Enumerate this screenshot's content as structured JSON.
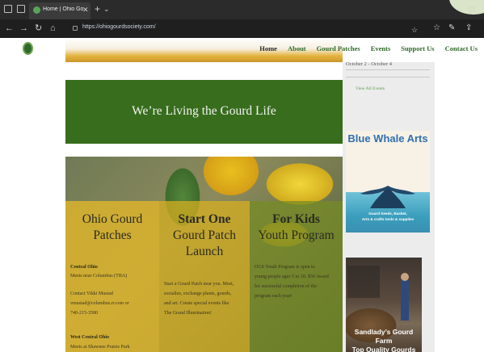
{
  "browser": {
    "tab_title": "Home | Ohio Gourd Soc",
    "tab_close": "✕",
    "new_tab": "+",
    "tab_menu": "⌄",
    "url": "https://ohiogourdsociety.com/",
    "window": {
      "minimize": "–",
      "restore": "◻"
    },
    "nav": {
      "back": "←",
      "forward": "→",
      "refresh": "↻",
      "home": "⌂"
    },
    "toolbar_icons": {
      "favorite_star": "☆",
      "collections": "☆",
      "profile": "✎",
      "share": "⇪"
    }
  },
  "site": {
    "nav": [
      "Home",
      "About",
      "Gourd Patches",
      "Events",
      "Support Us",
      "Contact Us"
    ],
    "banner": "We’re Living the Gourd Life",
    "columns": [
      {
        "title_line1": "Ohio Gourd",
        "title_line2": "Patches",
        "lines": [
          {
            "text": "Central Ohio",
            "bold": true
          },
          {
            "text": "Meets near Columbus (TBA)",
            "bold": false
          },
          {
            "text": "",
            "bold": false
          },
          {
            "text": "Contact Vikki Mustad",
            "bold": false
          },
          {
            "text": "vmustad@columbus.rr.com or",
            "bold": false
          },
          {
            "text": "740-215-3580",
            "bold": false
          },
          {
            "text": "",
            "bold": false
          },
          {
            "text": "West Central Ohio",
            "bold": true
          },
          {
            "text": "Meets at Shawnee Prairie Park",
            "bold": false
          }
        ]
      },
      {
        "title_line1": "Start One",
        "title_line2": "Gourd Patch",
        "title_line3": "Launch",
        "lines": [
          "Start a Gourd Patch near you. Meet,",
          "socialize, exchange plants, gourds,",
          "and art. Create special events like",
          "The Grand Illumination!"
        ]
      },
      {
        "title_line1": "For Kids",
        "title_line2": "Youth Program",
        "lines": [
          "OGS Youth Program is open to",
          "young people ages 5 to 18. $50 Award",
          "for successful completion of the",
          "program each year!"
        ]
      }
    ]
  },
  "sidebar": {
    "event_date": "October 2 - October 4",
    "view_all_events": "View All Events",
    "ad1": {
      "title": "Blue Whale Arts",
      "tagline_line1": "Gourd Seeds, Basket,",
      "tagline_line2": "Arts & crafts tools & supplies"
    },
    "ad2": {
      "line1": "Sandlady’s Gourd Farm",
      "line2": "Top Quality Gourds"
    }
  }
}
